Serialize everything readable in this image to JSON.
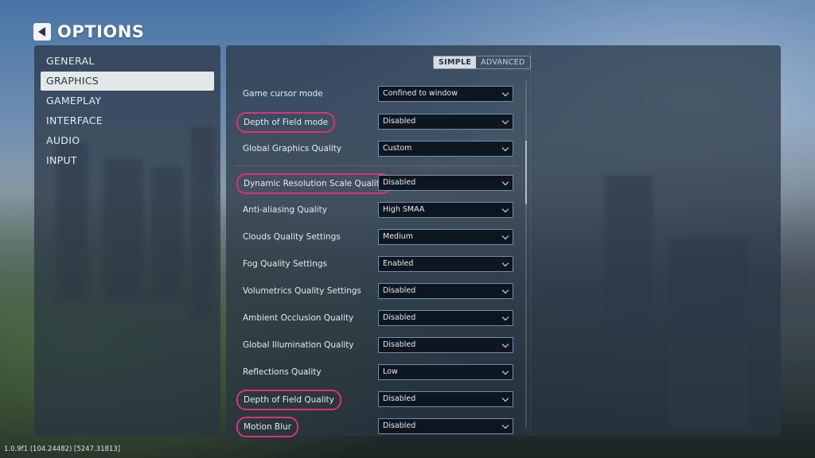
{
  "header": {
    "back_icon": "back-arrow-icon",
    "title": "OPTIONS"
  },
  "sidebar": {
    "items": [
      {
        "label": "GENERAL",
        "active": false
      },
      {
        "label": "GRAPHICS",
        "active": true
      },
      {
        "label": "GAMEPLAY",
        "active": false
      },
      {
        "label": "INTERFACE",
        "active": false
      },
      {
        "label": "AUDIO",
        "active": false
      },
      {
        "label": "INPUT",
        "active": false
      }
    ]
  },
  "mode_toggle": {
    "simple": "SIMPLE",
    "advanced": "ADVANCED",
    "selected": "SIMPLE"
  },
  "settings": [
    {
      "label": "Game cursor mode",
      "value": "Confined to window",
      "highlighted": false
    },
    {
      "label": "Depth of Field mode",
      "value": "Disabled",
      "highlighted": true
    },
    {
      "label": "Global Graphics Quality",
      "value": "Custom",
      "highlighted": false
    },
    {
      "label": "Dynamic Resolution Scale Quality",
      "value": "Disabled",
      "highlighted": true
    },
    {
      "label": "Anti-aliasing Quality",
      "value": "High SMAA",
      "highlighted": false
    },
    {
      "label": "Clouds Quality Settings",
      "value": "Medium",
      "highlighted": false
    },
    {
      "label": "Fog Quality Settings",
      "value": "Enabled",
      "highlighted": false
    },
    {
      "label": "Volumetrics Quality Settings",
      "value": "Disabled",
      "highlighted": false
    },
    {
      "label": "Ambient Occlusion Quality",
      "value": "Disabled",
      "highlighted": false
    },
    {
      "label": "Global Illumination Quality",
      "value": "Disabled",
      "highlighted": false
    },
    {
      "label": "Reflections Quality",
      "value": "Low",
      "highlighted": false
    },
    {
      "label": "Depth of Field Quality",
      "value": "Disabled",
      "highlighted": true
    },
    {
      "label": "Motion Blur",
      "value": "Disabled",
      "highlighted": true
    }
  ],
  "footer": {
    "version": "1.0.9f1 (104.24482) [5247.31813]"
  },
  "colors": {
    "highlight": "#e0307a",
    "dropdown_border": "#6c90b0"
  }
}
